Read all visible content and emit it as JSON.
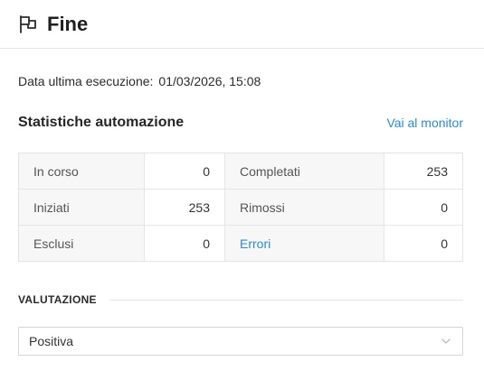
{
  "header": {
    "title": "Fine",
    "icon": "flag-icon"
  },
  "last_run": {
    "label": "Data ultima esecuzione:",
    "value": "01/03/2026, 15:08"
  },
  "stats_section": {
    "title": "Statistiche automazione",
    "monitor_link": "Vai al monitor",
    "link_color": "#2a8ad4",
    "rows": [
      {
        "left_label": "In corso",
        "left_value": "0",
        "right_label": "Completati",
        "right_value": "253"
      },
      {
        "left_label": "Iniziati",
        "left_value": "253",
        "right_label": "Rimossi",
        "right_value": "0"
      },
      {
        "left_label": "Esclusi",
        "left_value": "0",
        "right_label": "Errori",
        "right_value": "0"
      }
    ]
  },
  "evaluation": {
    "label": "VALUTAZIONE",
    "selected": "Positiva",
    "dropdown_icon": "chevron-down-icon"
  }
}
